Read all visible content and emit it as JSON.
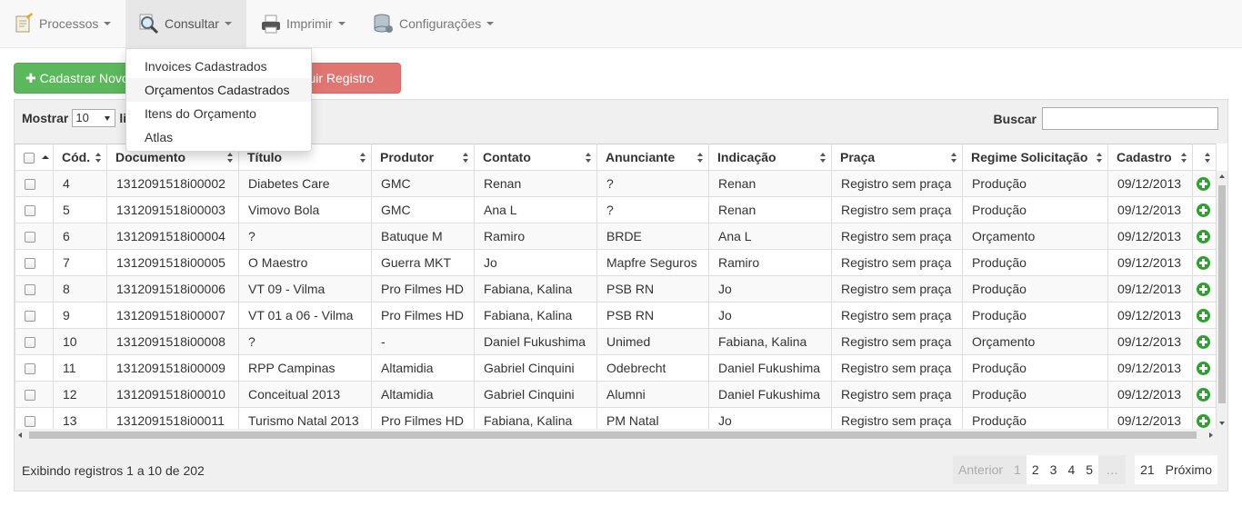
{
  "navbar": {
    "items": [
      {
        "label": "Processos",
        "icon": "notepad-pencil-icon"
      },
      {
        "label": "Consultar",
        "icon": "magnifier-icon",
        "active": true
      },
      {
        "label": "Imprimir",
        "icon": "printer-icon"
      },
      {
        "label": "Configurações",
        "icon": "database-settings-icon"
      }
    ],
    "dropdown": [
      "Invoices Cadastrados",
      "Orçamentos Cadastrados",
      "Itens do Orçamento",
      "Atlas"
    ]
  },
  "toolbar": {
    "add_label": "Cadastrar Novo",
    "delete_label": "Excluir Registro"
  },
  "controls": {
    "show_label": "Mostrar",
    "page_size": "10",
    "show_suffix": "li",
    "search_label": "Buscar",
    "search_value": ""
  },
  "table": {
    "columns": [
      "Cód.",
      "Documento",
      "Título",
      "Produtor",
      "Contato",
      "Anunciante",
      "Indicação",
      "Praça",
      "Regime Solicitação",
      "Cadastro"
    ],
    "rows": [
      [
        "4",
        "1312091518i00002",
        "Diabetes Care",
        "GMC",
        "Renan",
        "?",
        "Renan",
        "Registro sem praça",
        "Produção",
        "09/12/2013"
      ],
      [
        "5",
        "1312091518i00003",
        "Vimovo Bola",
        "GMC",
        "Ana L",
        "?",
        "Renan",
        "Registro sem praça",
        "Produção",
        "09/12/2013"
      ],
      [
        "6",
        "1312091518i00004",
        "?",
        "Batuque M",
        "Ramiro",
        "BRDE",
        "Ana L",
        "Registro sem praça",
        "Orçamento",
        "09/12/2013"
      ],
      [
        "7",
        "1312091518i00005",
        "O Maestro",
        "Guerra MKT",
        "Jo",
        "Mapfre Seguros",
        "Ramiro",
        "Registro sem praça",
        "Produção",
        "09/12/2013"
      ],
      [
        "8",
        "1312091518i00006",
        "VT 09 - Vilma",
        "Pro Filmes HD",
        "Fabiana, Kalina",
        "PSB RN",
        "Jo",
        "Registro sem praça",
        "Produção",
        "09/12/2013"
      ],
      [
        "9",
        "1312091518i00007",
        "VT 01 a 06 - Vilma",
        "Pro Filmes HD",
        "Fabiana, Kalina",
        "PSB RN",
        "Jo",
        "Registro sem praça",
        "Produção",
        "09/12/2013"
      ],
      [
        "10",
        "1312091518i00008",
        "?",
        "-",
        "Daniel Fukushima",
        "Unimed",
        "Fabiana, Kalina",
        "Registro sem praça",
        "Orçamento",
        "09/12/2013"
      ],
      [
        "11",
        "1312091518i00009",
        "RPP Campinas",
        "Altamidia",
        "Gabriel Cinquini",
        "Odebrecht",
        "Daniel Fukushima",
        "Registro sem praça",
        "Produção",
        "09/12/2013"
      ],
      [
        "12",
        "1312091518i00010",
        "Conceitual 2013",
        "Altamidia",
        "Gabriel Cinquini",
        "Alumni",
        "Daniel Fukushima",
        "Registro sem praça",
        "Produção",
        "09/12/2013"
      ],
      [
        "13",
        "1312091518i00011",
        "Turismo Natal 2013",
        "Pro Filmes HD",
        "Fabiana, Kalina",
        "PM Natal",
        "Jo",
        "Registro sem praça",
        "Produção",
        "09/12/2013"
      ]
    ]
  },
  "footer": {
    "info": "Exibindo registros 1 a 10 de 202",
    "prev": "Anterior",
    "pages": [
      "1",
      "2",
      "3",
      "4",
      "5"
    ],
    "ellipsis": "…",
    "last_page": "21",
    "next": "Próximo"
  },
  "colors": {
    "success": "#5cb85c",
    "danger": "#d9534f",
    "add_icon": "#2ea02e"
  }
}
